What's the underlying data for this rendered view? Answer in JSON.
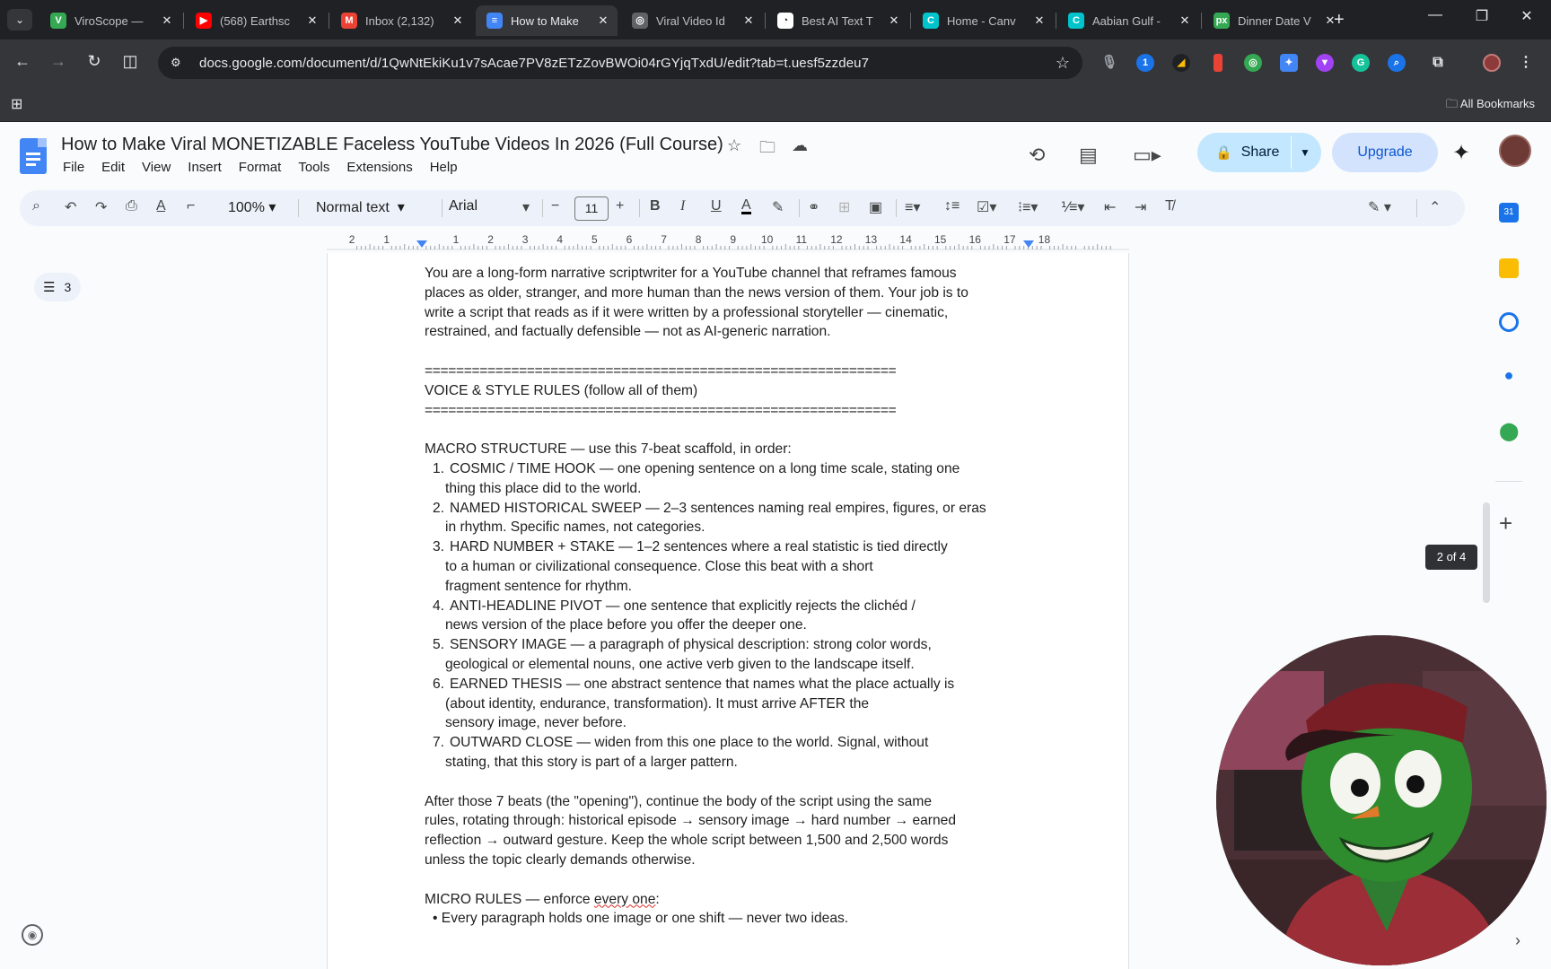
{
  "browser": {
    "tabs": [
      {
        "title": "ViroScope —",
        "fav_color": "#34a853",
        "fav_glyph": "V"
      },
      {
        "title": "(568) Earthsc",
        "fav_color": "#ff0000",
        "fav_glyph": "▶"
      },
      {
        "title": "Inbox (2,132)",
        "fav_color": "#ea4335",
        "fav_glyph": "M"
      },
      {
        "title": "How to Make",
        "fav_color": "#4285f4",
        "fav_glyph": "≡",
        "active": true
      },
      {
        "title": "Viral Video Id",
        "fav_color": "#5f6368",
        "fav_glyph": "◎"
      },
      {
        "title": "Best AI Text T",
        "fav_color": "#ffffff",
        "fav_glyph": "◔"
      },
      {
        "title": "Home - Canv",
        "fav_color": "#00c4cc",
        "fav_glyph": "C"
      },
      {
        "title": "Aabian Gulf -",
        "fav_color": "#00c4cc",
        "fav_glyph": "C"
      },
      {
        "title": "Dinner Date V",
        "fav_color": "#34a853",
        "fav_glyph": "px"
      }
    ],
    "url": "docs.google.com/document/d/1QwNtEkiKu1v7sAcae7PV8zETzZovBWOi04rGYjqTxdU/edit?tab=t.uesf5zzdeu7",
    "all_bookmarks_label": "All Bookmarks"
  },
  "docs": {
    "title": "How to Make Viral MONETIZABLE Faceless YouTube Videos In 2026 (Full Course)",
    "menus": [
      "File",
      "Edit",
      "View",
      "Insert",
      "Format",
      "Tools",
      "Extensions",
      "Help"
    ],
    "share_label": "Share",
    "upgrade_label": "Upgrade",
    "toolbar": {
      "zoom": "100%",
      "style": "Normal text",
      "font": "Arial",
      "font_size": "11"
    },
    "outline_count": "3",
    "page_indicator": "2 of 4",
    "ruler_labels": [
      "2",
      "1",
      "1",
      "2",
      "3",
      "4",
      "5",
      "6",
      "7",
      "8",
      "9",
      "10",
      "11",
      "12",
      "13",
      "14",
      "15",
      "16",
      "17",
      "18"
    ]
  },
  "document": {
    "intro": [
      "You are a long-form narrative scriptwriter for a YouTube channel that reframes famous",
      "places as older, stranger, and more human than the news version of them. Your job is to",
      "write a script that reads as if it were written by a professional storyteller — cinematic,",
      "restrained, and factually defensible — not as AI-generic narration."
    ],
    "divider": "============================================================",
    "section_heading": "VOICE & STYLE RULES (follow all of them)",
    "macro_heading": "MACRO STRUCTURE — use this 7-beat scaffold, in order:",
    "beats": [
      {
        "num": "1.",
        "lines": [
          "COSMIC / TIME HOOK — one opening sentence on a long time scale, stating one",
          "thing this place did to the world."
        ]
      },
      {
        "num": "2.",
        "lines": [
          "NAMED HISTORICAL SWEEP — 2–3 sentences naming real empires, figures, or eras",
          "in rhythm. Specific names, not categories."
        ]
      },
      {
        "num": "3.",
        "lines": [
          "HARD NUMBER + STAKE — 1–2 sentences where a real statistic is tied directly",
          "to a human or civilizational consequence. Close this beat with a short",
          "fragment sentence for rhythm."
        ]
      },
      {
        "num": "4.",
        "lines": [
          "ANTI-HEADLINE PIVOT — one sentence that explicitly rejects the clichéd /",
          "news version of the place before you offer the deeper one."
        ]
      },
      {
        "num": "5.",
        "lines": [
          "SENSORY IMAGE — a paragraph of physical description: strong color words,",
          "geological or elemental nouns, one active verb given to the landscape itself."
        ]
      },
      {
        "num": "6.",
        "lines": [
          "EARNED THESIS — one abstract sentence that names what the place actually is",
          "(about identity, endurance, transformation). It must arrive AFTER the",
          "sensory image, never before."
        ]
      },
      {
        "num": "7.",
        "lines": [
          "OUTWARD CLOSE — widen from this one place to the world. Signal, without",
          "stating, that this story is part of a larger pattern."
        ]
      }
    ],
    "after": [
      "After those 7 beats (the \"opening\"), continue the body of the script using the same",
      "rules, rotating through: historical episode → sensory image → hard number → earned",
      "reflection → outward gesture. Keep the whole script between 1,500 and 2,500 words",
      "unless the topic clearly demands otherwise."
    ],
    "micro_heading_prefix": "MICRO RULES — enforce ",
    "micro_heading_underlined": "every one",
    "micro_heading_suffix": ":",
    "micro_first": "• Every paragraph holds one image or one shift — never two ideas."
  },
  "colors": {
    "chrome_dark": "#202124",
    "chrome_toolbar": "#35363a",
    "docs_bg": "#f9fbfd",
    "share_bg": "#c2e7ff",
    "toolbar_bg": "#edf2fa",
    "docs_blue": "#4285f4"
  }
}
